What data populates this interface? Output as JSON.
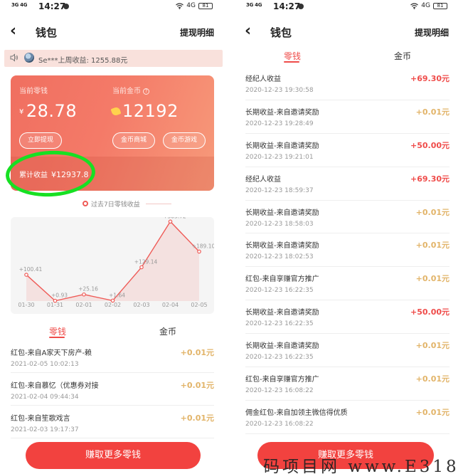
{
  "colors": {
    "accent": "#ef4c4a",
    "card_start": "#f06f60",
    "card_end": "#f79a7a",
    "gold_amount": "#e2b469",
    "annotation": "#17e023"
  },
  "status_bar": {
    "signal": "3G 4G",
    "time": "14:27",
    "network": "4G",
    "battery": "81"
  },
  "left": {
    "nav": {
      "back": "‹",
      "title": "钱包",
      "action": "提现明细"
    },
    "notice": {
      "text": "Se***上周收益: 1255.88元"
    },
    "card": {
      "change_label": "当前零钱",
      "change_currency": "¥",
      "change_value": "28.78",
      "coins_label": "当前金币",
      "help": "?",
      "coins_value": "12192",
      "btn_withdraw": "立即提现",
      "btn_mall": "金币商城",
      "btn_games": "金币游戏",
      "total_label": "累计收益",
      "total_value": "¥12937.8"
    },
    "chart_caption": "过去7日零钱收益",
    "tabs": {
      "change": "零钱",
      "coins": "金币"
    },
    "transactions": [
      {
        "desc": "红包-来自A家天下房产-赖",
        "time": "2021-02-05 10:02:13",
        "amount": "+0.01元"
      },
      {
        "desc": "红包-来自慕忆（优惠券对接",
        "time": "2021-02-04 09:44:34",
        "amount": "+0.01元"
      },
      {
        "desc": "红包-来自笙歌戏言",
        "time": "2021-02-03 19:17:37",
        "amount": "+0.01元"
      }
    ],
    "cta": "赚取更多零钱"
  },
  "chart_data": {
    "type": "line",
    "title": "",
    "xlabel": "",
    "ylabel": "",
    "categories": [
      "01-30",
      "01-31",
      "02-01",
      "02-02",
      "02-03",
      "02-04",
      "02-05"
    ],
    "values": [
      100.41,
      0.93,
      25.16,
      1.64,
      129.14,
      303.72,
      189.1
    ],
    "value_labels": [
      "+100.41",
      "+0.93",
      "+25.16",
      "+1.64",
      "+129.14",
      "+303.72",
      "+189.10"
    ],
    "ylim": [
      0,
      310
    ],
    "area_fill": true,
    "grid": false,
    "line_color": "#ef5b57"
  },
  "right": {
    "nav": {
      "back": "‹",
      "title": "钱包",
      "action": "提现明细"
    },
    "tabs": {
      "change": "零钱",
      "coins": "金币"
    },
    "transactions": [
      {
        "desc": "经纪人收益",
        "time": "2020-12-23 19:30:58",
        "amount": "+69.30元",
        "style": "red"
      },
      {
        "desc": "长期收益-来自邀请奖励",
        "time": "2020-12-23 19:28:49",
        "amount": "+0.01元",
        "style": "gold"
      },
      {
        "desc": "长期收益-来自邀请奖励",
        "time": "2020-12-23 19:21:01",
        "amount": "+50.00元",
        "style": "red"
      },
      {
        "desc": "经纪人收益",
        "time": "2020-12-23 18:59:37",
        "amount": "+69.30元",
        "style": "red"
      },
      {
        "desc": "长期收益-来自邀请奖励",
        "time": "2020-12-23 18:58:03",
        "amount": "+0.01元",
        "style": "gold"
      },
      {
        "desc": "长期收益-来自邀请奖励",
        "time": "2020-12-23 18:02:53",
        "amount": "+0.01元",
        "style": "gold"
      },
      {
        "desc": "红包-来自享赚官方推广",
        "time": "2020-12-23 16:22:35",
        "amount": "+0.01元",
        "style": "gold"
      },
      {
        "desc": "长期收益-来自邀请奖励",
        "time": "2020-12-23 16:22:35",
        "amount": "+50.00元",
        "style": "red"
      },
      {
        "desc": "长期收益-来自邀请奖励",
        "time": "2020-12-23 16:22:35",
        "amount": "+0.01元",
        "style": "gold"
      },
      {
        "desc": "红包-来自享赚官方推广",
        "time": "2020-12-23 16:08:22",
        "amount": "+0.01元",
        "style": "gold"
      },
      {
        "desc": "佣金红包-来自加领主微信得优质",
        "time": "2020-12-23 16:08:22",
        "amount": "+0.01元",
        "style": "gold"
      }
    ],
    "cta": "赚取更多零钱"
  },
  "watermark": "码项目网 www.E318"
}
